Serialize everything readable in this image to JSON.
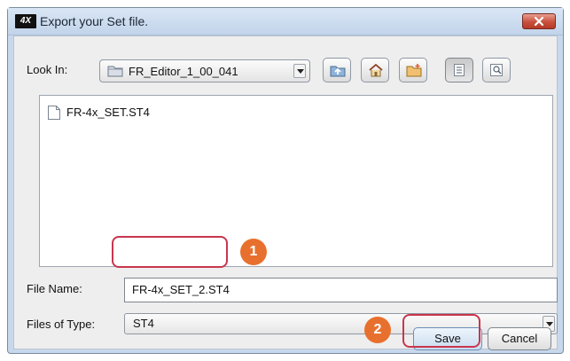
{
  "window": {
    "app_icon_text": "4X",
    "title": "Export your Set file.",
    "close_icon": "close-x-icon"
  },
  "look_in": {
    "label": "Look In:",
    "folder_icon": "folder-icon",
    "value": "FR_Editor_1_00_041"
  },
  "toolbar": [
    {
      "name": "up-one-level-button",
      "icon": "up-folder-icon"
    },
    {
      "name": "home-button",
      "icon": "home-icon"
    },
    {
      "name": "new-folder-button",
      "icon": "new-folder-icon"
    },
    {
      "name": "list-view-button",
      "icon": "list-view-icon",
      "pressed": true
    },
    {
      "name": "details-view-button",
      "icon": "details-view-icon"
    }
  ],
  "files": [
    {
      "name": "FR-4x_SET.ST4",
      "icon": "file-icon"
    }
  ],
  "file_name": {
    "label": "File Name:",
    "value": "FR-4x_SET_2.ST4"
  },
  "files_of_type": {
    "label": "Files of Type:",
    "value": "ST4"
  },
  "buttons": {
    "save": "Save",
    "cancel": "Cancel"
  },
  "callouts": {
    "one": "1",
    "two": "2",
    "color": "#e8702e",
    "highlight_color": "#c8364e"
  }
}
